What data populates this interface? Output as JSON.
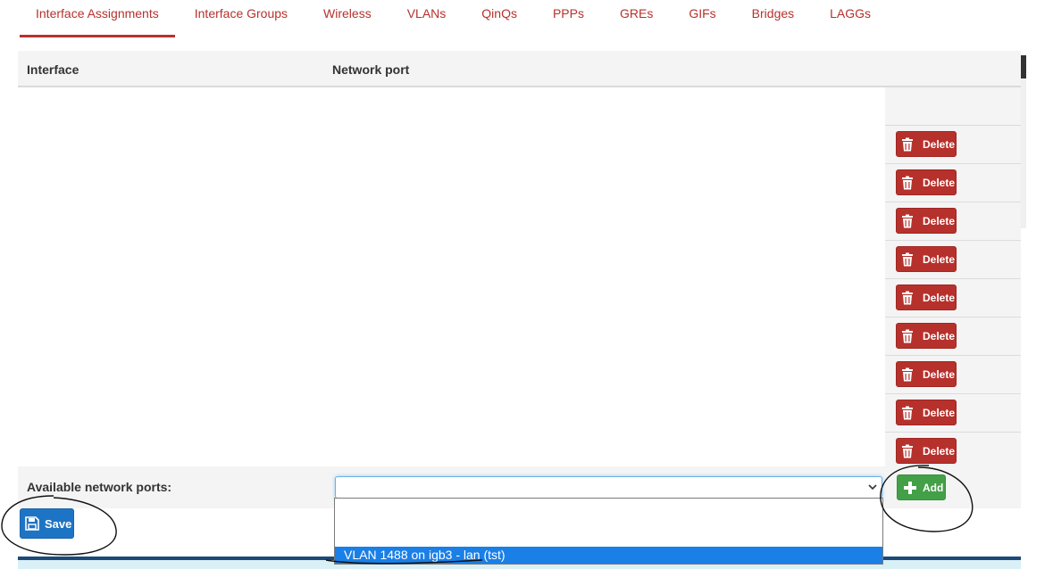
{
  "tabs": [
    {
      "label": "Interface Assignments",
      "active": true
    },
    {
      "label": "Interface Groups"
    },
    {
      "label": "Wireless"
    },
    {
      "label": "VLANs"
    },
    {
      "label": "QinQs"
    },
    {
      "label": "PPPs"
    },
    {
      "label": "GREs"
    },
    {
      "label": "GIFs"
    },
    {
      "label": "Bridges"
    },
    {
      "label": "LAGGs"
    }
  ],
  "table": {
    "col_interface": "Interface",
    "col_network_port": "Network port"
  },
  "rows": [
    {
      "action": "Delete"
    },
    {
      "action": "Delete"
    },
    {
      "action": "Delete"
    },
    {
      "action": "Delete"
    },
    {
      "action": "Delete"
    },
    {
      "action": "Delete"
    },
    {
      "action": "Delete"
    },
    {
      "action": "Delete"
    },
    {
      "action": "Delete"
    }
  ],
  "available": {
    "label": "Available network ports:",
    "selected_value": "",
    "add_label": "Add"
  },
  "save_label": "Save",
  "dropdown": {
    "options": [
      "",
      "",
      "VLAN 1488 on igb3 - lan (tst)"
    ],
    "selected_index": 2
  },
  "colors": {
    "accent_red": "#b7312c",
    "add_green": "#43a047",
    "save_blue": "#1e74c4",
    "selected_option": "#1a7fe6"
  }
}
